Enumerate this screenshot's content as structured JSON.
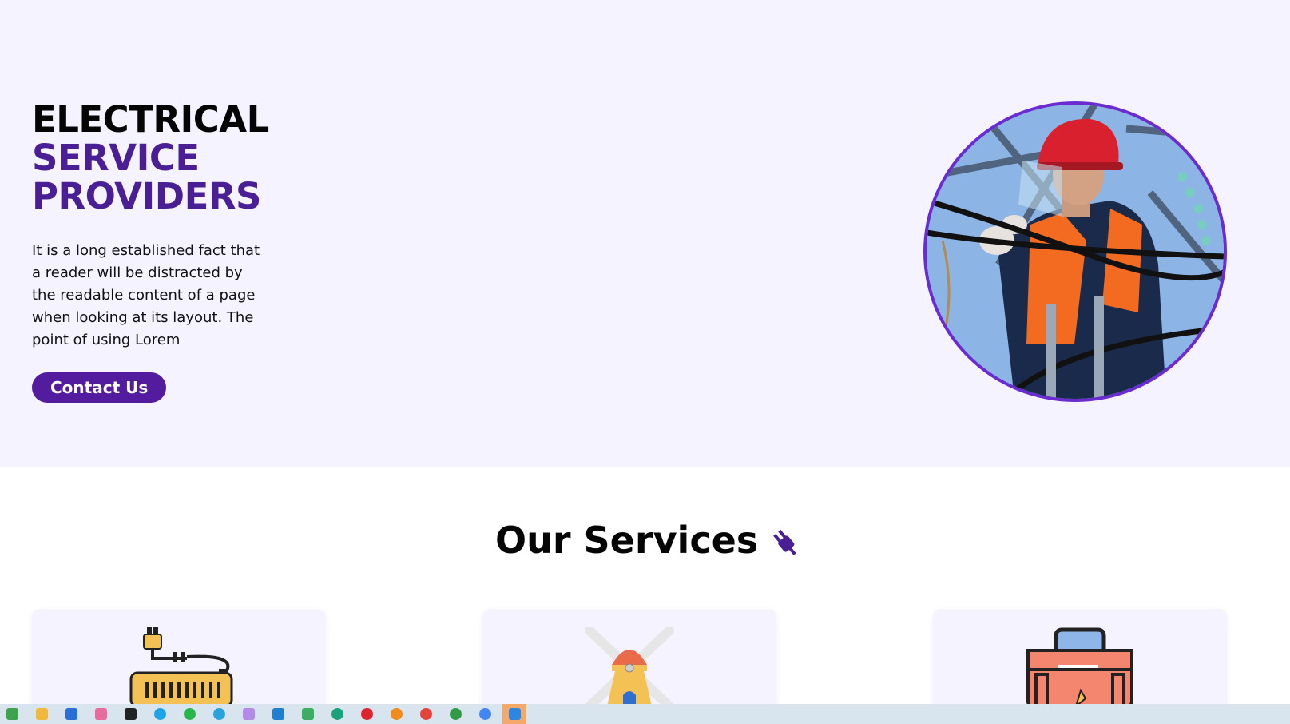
{
  "hero": {
    "title_line_1": "ELECTRICAL",
    "title_line_2": "SERVICE",
    "title_line_3": "PROVIDERS",
    "description": "It is a long established fact that a reader will be distracted by the readable content of a page when looking at its layout. The point of using Lorem",
    "contact_label": "Contact Us",
    "colors": {
      "background": "#f5f3ff",
      "accent": "#531c9e",
      "title_accent": "#4a1f96",
      "image_border": "#6a2bd0"
    }
  },
  "services": {
    "heading": "Our Services",
    "heading_icon": "plug-icon",
    "cards": [
      {
        "icon": "power-strip-icon"
      },
      {
        "icon": "windmill-icon"
      },
      {
        "icon": "toolbox-icon"
      }
    ]
  },
  "taskbar": {
    "apps": [
      {
        "icon": "app-icon",
        "color": "#3fa34d"
      },
      {
        "icon": "file-explorer-icon",
        "color": "#f2b83c"
      },
      {
        "icon": "store-icon",
        "color": "#2b6fd6"
      },
      {
        "icon": "paint-icon",
        "color": "#e76b9d"
      },
      {
        "icon": "security-icon",
        "color": "#222222"
      },
      {
        "icon": "skype-icon",
        "color": "#1fa3e8"
      },
      {
        "icon": "whatsapp-icon",
        "color": "#27b64b"
      },
      {
        "icon": "telegram-icon",
        "color": "#2aa3dd"
      },
      {
        "icon": "app-icon",
        "color": "#b48ae8"
      },
      {
        "icon": "vscode-icon",
        "color": "#1f7fd1"
      },
      {
        "icon": "app-icon",
        "color": "#3cae64"
      },
      {
        "icon": "edge-icon",
        "color": "#1aa27a"
      },
      {
        "icon": "opera-icon",
        "color": "#e0242d"
      },
      {
        "icon": "firefox-icon",
        "color": "#f28b1d"
      },
      {
        "icon": "chrome-icon",
        "color": "#e2443c"
      },
      {
        "icon": "chrome-icon",
        "color": "#2f9c45"
      },
      {
        "icon": "chrome-icon",
        "color": "#4285f4"
      },
      {
        "icon": "photos-icon",
        "color": "#2f86e0"
      }
    ]
  }
}
